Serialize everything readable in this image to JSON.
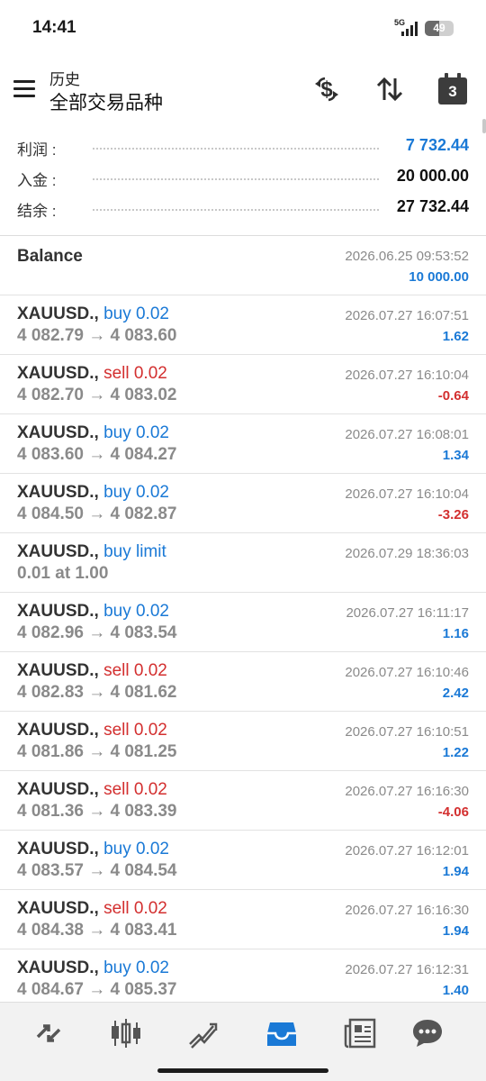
{
  "status": {
    "time": "14:41",
    "network": "5G",
    "battery": "49",
    "battery_level": 0.49
  },
  "header": {
    "title": "历史",
    "subtitle": "全部交易品种",
    "calendar_day": "3",
    "icons": [
      "menu-icon",
      "dollar-exchange-icon",
      "sort-icon",
      "calendar-icon"
    ]
  },
  "summary": {
    "profit_label": "利润 :",
    "profit_value": "7 732.44",
    "deposit_label": "入金 :",
    "deposit_value": "20 000.00",
    "balance_label": "结余 :",
    "balance_value": "27 732.44"
  },
  "balance_entry": {
    "title": "Balance",
    "time": "2026.06.25 09:53:52",
    "amount": "10 000.00"
  },
  "deals": [
    {
      "symbol": "XAUUSD.,",
      "type": " buy 0.02",
      "side": "buy",
      "prices": "4 082.79 → 4 083.60",
      "time": "2026.07.27 16:07:51",
      "profit": "1.62",
      "negative": false
    },
    {
      "symbol": "XAUUSD.,",
      "type": " sell 0.02",
      "side": "sell",
      "prices": "4 082.70 → 4 083.02",
      "time": "2026.07.27 16:10:04",
      "profit": "-0.64",
      "negative": true
    },
    {
      "symbol": "XAUUSD.,",
      "type": " buy 0.02",
      "side": "buy",
      "prices": "4 083.60 → 4 084.27",
      "time": "2026.07.27 16:08:01",
      "profit": "1.34",
      "negative": false
    },
    {
      "symbol": "XAUUSD.,",
      "type": " buy 0.02",
      "side": "buy",
      "prices": "4 084.50 → 4 082.87",
      "time": "2026.07.27 16:10:04",
      "profit": "-3.26",
      "negative": true
    },
    {
      "symbol": "XAUUSD.,",
      "type": " buy limit",
      "side": "buy",
      "prices": "0.01 at 1.00",
      "time": "2026.07.29 18:36:03",
      "profit": "",
      "negative": false
    },
    {
      "symbol": "XAUUSD.,",
      "type": " buy 0.02",
      "side": "buy",
      "prices": "4 082.96 → 4 083.54",
      "time": "2026.07.27 16:11:17",
      "profit": "1.16",
      "negative": false
    },
    {
      "symbol": "XAUUSD.,",
      "type": " sell 0.02",
      "side": "sell",
      "prices": "4 082.83 → 4 081.62",
      "time": "2026.07.27 16:10:46",
      "profit": "2.42",
      "negative": false
    },
    {
      "symbol": "XAUUSD.,",
      "type": " sell 0.02",
      "side": "sell",
      "prices": "4 081.86 → 4 081.25",
      "time": "2026.07.27 16:10:51",
      "profit": "1.22",
      "negative": false
    },
    {
      "symbol": "XAUUSD.,",
      "type": " sell 0.02",
      "side": "sell",
      "prices": "4 081.36 → 4 083.39",
      "time": "2026.07.27 16:16:30",
      "profit": "-4.06",
      "negative": true
    },
    {
      "symbol": "XAUUSD.,",
      "type": " buy 0.02",
      "side": "buy",
      "prices": "4 083.57 → 4 084.54",
      "time": "2026.07.27 16:12:01",
      "profit": "1.94",
      "negative": false
    },
    {
      "symbol": "XAUUSD.,",
      "type": " sell 0.02",
      "side": "sell",
      "prices": "4 084.38 → 4 083.41",
      "time": "2026.07.27 16:16:30",
      "profit": "1.94",
      "negative": false
    },
    {
      "symbol": "XAUUSD.,",
      "type": " buy 0.02",
      "side": "buy",
      "prices": "4 084.67 → 4 085.37",
      "time": "2026.07.27 16:12:31",
      "profit": "1.40",
      "negative": false
    }
  ],
  "bottom_nav": [
    {
      "name": "quotes-icon",
      "active": false
    },
    {
      "name": "chart-icon",
      "active": false
    },
    {
      "name": "trade-icon",
      "active": false
    },
    {
      "name": "history-icon",
      "active": true
    },
    {
      "name": "news-icon",
      "active": false
    },
    {
      "name": "messages-icon",
      "active": false
    }
  ],
  "colors": {
    "accent": "#1a79d6",
    "negative": "#d32f2f",
    "muted": "#8a8a8a",
    "nav_icon": "#555555"
  }
}
